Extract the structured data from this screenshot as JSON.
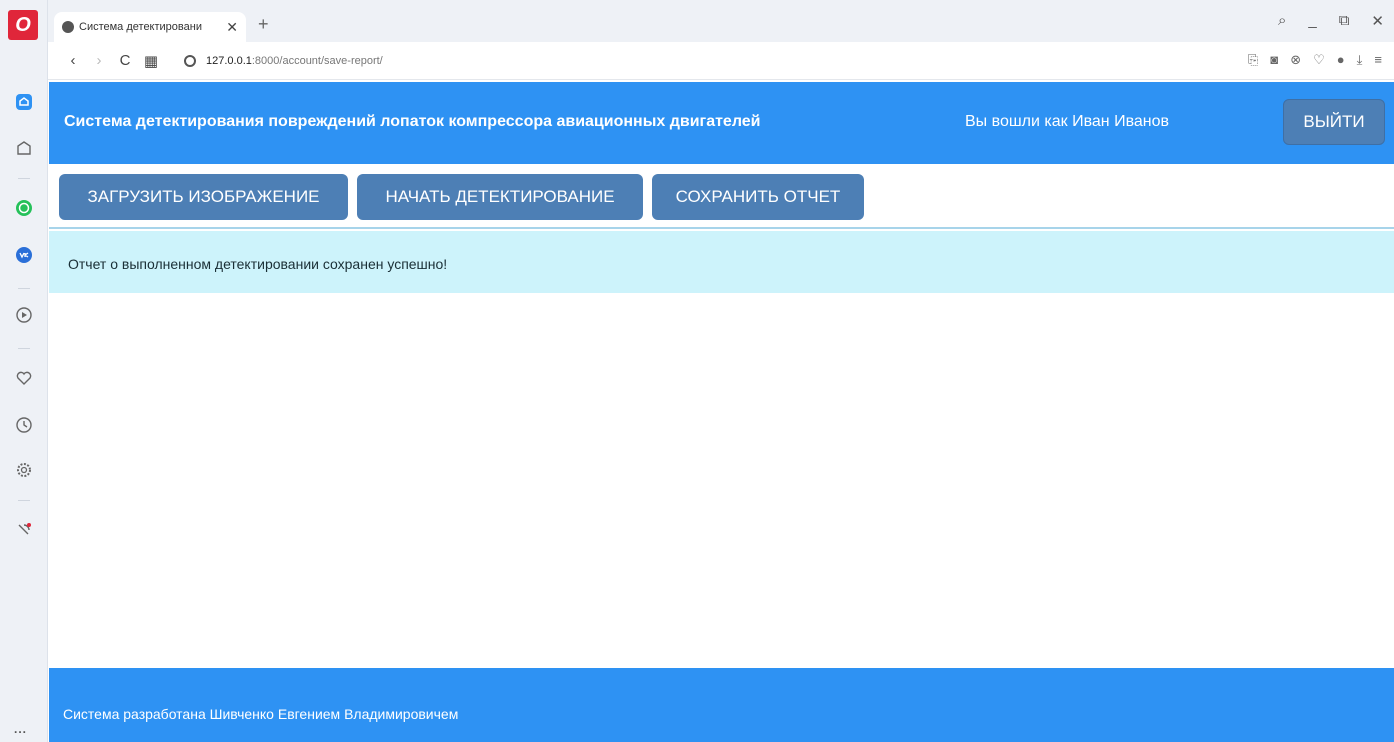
{
  "browser": {
    "logo_letter": "O",
    "tab": {
      "title": "Система детектировани",
      "close_glyph": "✕"
    },
    "new_tab_glyph": "+",
    "window_controls": [
      "⌕",
      "_",
      "⧉",
      "✕"
    ],
    "nav": {
      "back_glyph": "‹",
      "forward_glyph": "›",
      "reload_glyph": "C",
      "tabs_glyph": "▦"
    },
    "url": {
      "host": "127.0.0.1",
      "rest": ":8000/account/save-report/"
    },
    "toolbar_icons": [
      "camera-icon",
      "snapshot-icon",
      "block-icon",
      "heart-icon",
      "profile-icon",
      "download-icon",
      "menu-icon"
    ],
    "sidebar_icons": [
      "home-icon",
      "bookmark-icon",
      "whatsapp-icon",
      "vk-icon",
      "player-icon",
      "heart-icon",
      "history-icon",
      "settings-icon",
      "pinboard-icon"
    ],
    "more_glyph": "..."
  },
  "app": {
    "title": "Система детектирования повреждений лопаток компрессора авиационных двигателей",
    "user_info": "Вы вошли как Иван Иванов",
    "logout_label": "ВЫЙТИ",
    "buttons": {
      "upload": "ЗАГРУЗИТЬ ИЗОБРАЖЕНИЕ",
      "detect": "НАЧАТЬ ДЕТЕКТИРОВАНИЕ",
      "save": "СОХРАНИТЬ ОТЧЕТ"
    },
    "alert": "Отчет о выполненном детектировании сохранен успешно!",
    "footer": "Система разработана Шивченко Евгением Владимировичем"
  },
  "colors": {
    "header_bg": "#2e92f3",
    "button_bg": "#4d7fb5",
    "alert_bg": "#cdf3fb",
    "opera_red": "#e0263a"
  }
}
